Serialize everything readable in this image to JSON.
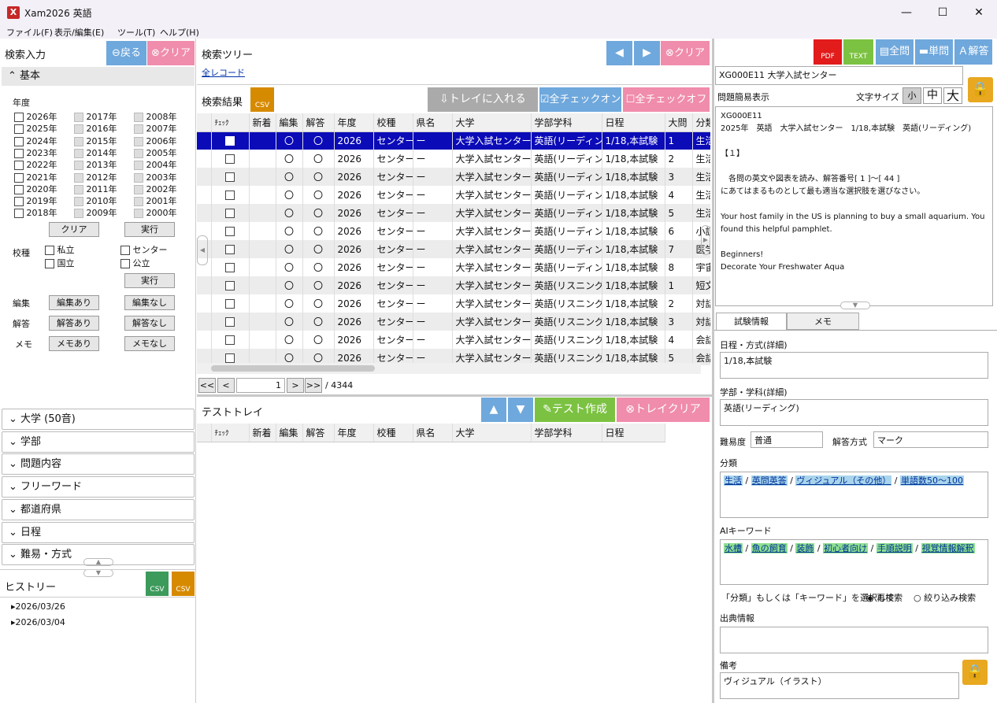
{
  "window": {
    "title": "Xam2026 英語",
    "min": "—",
    "max": "☐",
    "close": "✕"
  },
  "menu": [
    "ファイル(F)",
    "表示/編集(E)",
    "ツール(T)",
    "ヘルプ(H)"
  ],
  "left": {
    "title": "検索入力",
    "back": "戻る",
    "clear": "クリア",
    "basic": "基本",
    "year_label": "年度",
    "years_col1": [
      "2026年",
      "2025年",
      "2024年",
      "2023年",
      "2022年",
      "2021年",
      "2020年",
      "2019年",
      "2018年"
    ],
    "years_col2": [
      "2017年",
      "2016年",
      "2015年",
      "2014年",
      "2013年",
      "2012年",
      "2011年",
      "2010年",
      "2009年"
    ],
    "years_col3": [
      "2008年",
      "2007年",
      "2006年",
      "2005年",
      "2004年",
      "2003年",
      "2002年",
      "2001年",
      "2000年"
    ],
    "year_clear": "クリア",
    "year_run": "実行",
    "school_label": "校種",
    "school_opts": [
      "私立",
      "センター",
      "国立",
      "公立"
    ],
    "school_run": "実行",
    "edit_label": "編集",
    "edit_yes": "編集あり",
    "edit_no": "編集なし",
    "ans_label": "解答",
    "ans_yes": "解答あり",
    "ans_no": "解答なし",
    "memo_label": "メモ",
    "memo_yes": "メモあり",
    "memo_no": "メモなし",
    "accordions": [
      "大学 (50音)",
      "学部",
      "問題内容",
      "フリーワード",
      "都道府県",
      "日程",
      "難易・方式"
    ],
    "history_title": "ヒストリー",
    "history": [
      "2026/03/26",
      "2026/03/04"
    ]
  },
  "center": {
    "tree_title": "検索ツリー",
    "tree_clear": "クリア",
    "all_records": "全レコード",
    "results_title": "検索結果",
    "tray_in": "トレイに入れる",
    "check_all_on": "全チェックオン",
    "check_all_off": "全チェックオフ",
    "columns": [
      "ﾁｪｯｸ",
      "新着",
      "編集",
      "解答",
      "年度",
      "校種",
      "県名",
      "大学",
      "学部学科",
      "日程",
      "大問",
      "分類"
    ],
    "rows": [
      [
        "",
        "",
        "〇",
        "〇",
        "2026",
        "センター",
        "ー",
        "大学入試センター",
        "英語(リーディング)",
        "1/18,本試験",
        "1",
        "生活"
      ],
      [
        "",
        "",
        "〇",
        "〇",
        "2026",
        "センター",
        "ー",
        "大学入試センター",
        "英語(リーディング)",
        "1/18,本試験",
        "2",
        "生活"
      ],
      [
        "",
        "",
        "〇",
        "〇",
        "2026",
        "センター",
        "ー",
        "大学入試センター",
        "英語(リーディング)",
        "1/18,本試験",
        "3",
        "生活"
      ],
      [
        "",
        "",
        "〇",
        "〇",
        "2026",
        "センター",
        "ー",
        "大学入試センター",
        "英語(リーディング)",
        "1/18,本試験",
        "4",
        "生活"
      ],
      [
        "",
        "",
        "〇",
        "〇",
        "2026",
        "センター",
        "ー",
        "大学入試センター",
        "英語(リーディング)",
        "1/18,本試験",
        "5",
        "生活"
      ],
      [
        "",
        "",
        "〇",
        "〇",
        "2026",
        "センター",
        "ー",
        "大学入試センター",
        "英語(リーディング)",
        "1/18,本試験",
        "6",
        "小説"
      ],
      [
        "",
        "",
        "〇",
        "〇",
        "2026",
        "センター",
        "ー",
        "大学入試センター",
        "英語(リーディング)",
        "1/18,本試験",
        "7",
        "医学"
      ],
      [
        "",
        "",
        "〇",
        "〇",
        "2026",
        "センター",
        "ー",
        "大学入試センター",
        "英語(リーディング)",
        "1/18,本試験",
        "8",
        "宇宙"
      ],
      [
        "",
        "",
        "〇",
        "〇",
        "2026",
        "センター",
        "ー",
        "大学入試センター",
        "英語(リスニング)",
        "1/18,本試験",
        "1",
        "短文"
      ],
      [
        "",
        "",
        "〇",
        "〇",
        "2026",
        "センター",
        "ー",
        "大学入試センター",
        "英語(リスニング)",
        "1/18,本試験",
        "2",
        "対話"
      ],
      [
        "",
        "",
        "〇",
        "〇",
        "2026",
        "センター",
        "ー",
        "大学入試センター",
        "英語(リスニング)",
        "1/18,本試験",
        "3",
        "対話"
      ],
      [
        "",
        "",
        "〇",
        "〇",
        "2026",
        "センター",
        "ー",
        "大学入試センター",
        "英語(リスニング)",
        "1/18,本試験",
        "4",
        "会話"
      ],
      [
        "",
        "",
        "〇",
        "〇",
        "2026",
        "センター",
        "ー",
        "大学入試センター",
        "英語(リスニング)",
        "1/18,本試験",
        "5",
        "会話"
      ]
    ],
    "pager": {
      "first": "<<",
      "prev": "<",
      "page": "1",
      "next": ">",
      "last": ">>",
      "total": "/ 4344"
    },
    "tray_title": "テストトレイ",
    "make_test": "テスト作成",
    "tray_clear": "トレイクリア",
    "tray_columns": [
      "ﾁｪｯｸ",
      "新着",
      "編集",
      "解答",
      "年度",
      "校種",
      "県名",
      "大学",
      "学部学科",
      "日程"
    ]
  },
  "right": {
    "pdf": "PDF",
    "text": "TEXT",
    "all_q": "全問",
    "single_q": "単問",
    "answer": "解答",
    "record_title": "XG000E11 大学入試センター",
    "preview_label": "問題簡易表示",
    "font_size_label": "文字サイズ",
    "sizes": [
      "小",
      "中",
      "大"
    ],
    "preview_lines": [
      "XG000E11",
      "2025年　英語　大学入試センター　1/18,本試験　英語(リーディング)",
      "",
      "【１】",
      "",
      "　各問の英文や図表を読み、解答番号[ 1 ]～[ 44 ]",
      "にあてはまるものとして最も適当な選択肢を選びなさい。",
      "",
      "Your host family in the US is planning to buy a small aquarium. You found this helpful pamphlet.",
      "",
      "Beginners!",
      "Decorate Your Freshwater Aqua"
    ],
    "tab_exam": "試験情報",
    "tab_memo": "メモ",
    "schedule_label": "日程・方式(詳細)",
    "schedule": "1/18,本試験",
    "dept_label": "学部・学科(詳細)",
    "dept": "英語(リーディング)",
    "difficulty_label": "難易度",
    "difficulty": "普通",
    "method_label": "解答方式",
    "method": "マーク",
    "class_label": "分類",
    "classes": [
      "生活",
      "英問英答",
      "ヴィジュアル（その他）",
      "単語数50～100"
    ],
    "ai_label": "AIキーワード",
    "keywords": [
      "水槽",
      "魚の飼育",
      "装飾",
      "初心者向け",
      "手順説明",
      "視覚情報解釈"
    ],
    "search_hint": "「分類」もしくは「キーワード」を選択して",
    "opt_research": "再検索",
    "opt_filter": "絞り込み検索",
    "source_label": "出典情報",
    "source": "",
    "notes_label": "備考",
    "notes": "ヴィジュアル（イラスト）",
    "colors": {
      "pdf": "#e21b1b",
      "text": "#7cc242",
      "blue": "#6fa8dc",
      "pink": "#f08cac",
      "green": "#7cc242",
      "selected": "#0b0bb8"
    }
  }
}
